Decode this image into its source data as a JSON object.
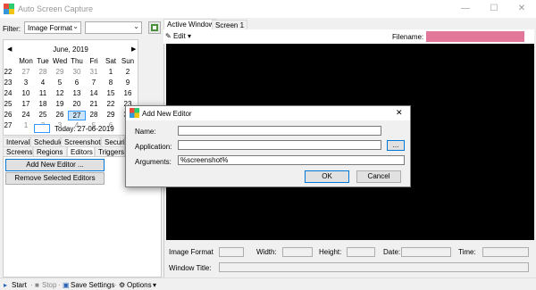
{
  "window": {
    "title": "Auto Screen Capture",
    "minimize": "—",
    "maximize": "☐",
    "close": "✕"
  },
  "filter": {
    "label": "Filter:",
    "type_value": "Image Format",
    "value": ""
  },
  "calendar": {
    "title": "June, 2019",
    "prev": "◀",
    "next": "▶",
    "day_headers": [
      "Mon",
      "Tue",
      "Wed",
      "Thu",
      "Fri",
      "Sat",
      "Sun"
    ],
    "weeks": [
      {
        "wk": "22",
        "days": [
          "27",
          "28",
          "29",
          "30",
          "31",
          "1",
          "2"
        ]
      },
      {
        "wk": "23",
        "days": [
          "3",
          "4",
          "5",
          "6",
          "7",
          "8",
          "9"
        ]
      },
      {
        "wk": "24",
        "days": [
          "10",
          "11",
          "12",
          "13",
          "14",
          "15",
          "16"
        ]
      },
      {
        "wk": "25",
        "days": [
          "17",
          "18",
          "19",
          "20",
          "21",
          "22",
          "23"
        ]
      },
      {
        "wk": "26",
        "days": [
          "24",
          "25",
          "26",
          "27",
          "28",
          "29",
          "30"
        ]
      },
      {
        "wk": "27",
        "days": [
          "1",
          "2",
          "3",
          "4",
          "5",
          "6",
          "7"
        ]
      }
    ],
    "today_label": "Today: 27-06-2019"
  },
  "left_tabs_row1": [
    "Interval",
    "Schedule",
    "Screenshots",
    "Securi"
  ],
  "left_tabs_row2": [
    "Screens",
    "Regions",
    "Editors",
    "Triggers"
  ],
  "left_scroll": {
    "left": "◀",
    "right": "▶"
  },
  "editors": {
    "add_button": "Add New Editor ...",
    "remove_button": "Remove Selected Editors"
  },
  "right_tabs": [
    "Active Window",
    "Screen 1"
  ],
  "edit_menu": {
    "label": "Edit",
    "arrow": "▾"
  },
  "filename_label": "Filename:",
  "info_fields": {
    "image_format": "Image Format",
    "width": "Width:",
    "height": "Height:",
    "date": "Date:",
    "time": "Time:",
    "window_title": "Window Title:"
  },
  "status_bar": {
    "start": "Start",
    "stop": "Stop",
    "save_settings": "Save Settings",
    "options": "Options",
    "separator": "·"
  },
  "dialog": {
    "title": "Add New Editor",
    "close": "✕",
    "name_label": "Name:",
    "name_value": "",
    "application_label": "Application:",
    "application_value": "",
    "browse": "...",
    "arguments_label": "Arguments:",
    "arguments_value": "%screenshot%",
    "ok": "OK",
    "cancel": "Cancel"
  },
  "colors": {
    "filename_bg": "#e2779a",
    "accent": "#0078d7"
  }
}
